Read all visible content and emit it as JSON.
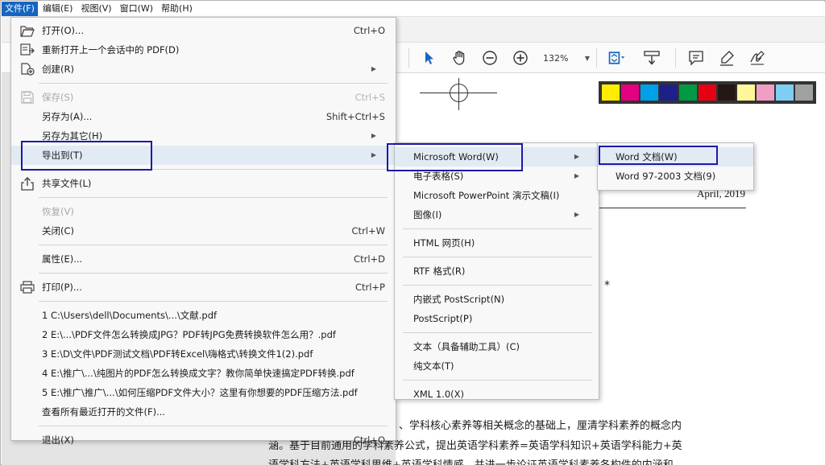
{
  "menubar": {
    "items": [
      "文件(F)",
      "编辑(E)",
      "视图(V)",
      "窗口(W)",
      "帮助(H)"
    ]
  },
  "toolbar": {
    "zoom": "132%",
    "icons": [
      "select-arrow-icon",
      "hand-icon",
      "zoom-out-icon",
      "zoom-in-icon",
      "fit-page-icon",
      "scroll-mode-icon",
      "comment-icon",
      "highlight-pen-icon",
      "sign-icon"
    ]
  },
  "swatches": [
    "#ffee00",
    "#e4007f",
    "#00a0e9",
    "#1d2088",
    "#009944",
    "#e60012",
    "#231815",
    "#fff799",
    "#f19ec2",
    "#7ecef4",
    "#9fa0a0"
  ],
  "file_menu": {
    "open": {
      "label": "打开(O)...",
      "shortcut": "Ctrl+O"
    },
    "reopen": {
      "label": "重新打开上一个会话中的 PDF(D)"
    },
    "create": {
      "label": "创建(R)"
    },
    "save": {
      "label": "保存(S)",
      "shortcut": "Ctrl+S"
    },
    "save_as": {
      "label": "另存为(A)...",
      "shortcut": "Shift+Ctrl+S"
    },
    "save_as_other": {
      "label": "另存为其它(H)"
    },
    "export_to": {
      "label": "导出到(T)"
    },
    "share": {
      "label": "共享文件(L)"
    },
    "revert": {
      "label": "恢复(V)"
    },
    "close": {
      "label": "关闭(C)",
      "shortcut": "Ctrl+W"
    },
    "properties": {
      "label": "属性(E)...",
      "shortcut": "Ctrl+D"
    },
    "print": {
      "label": "打印(P)...",
      "shortcut": "Ctrl+P"
    },
    "recent": [
      "1 C:\\Users\\dell\\Documents\\...\\文献.pdf",
      "2 E:\\...\\PDF文件怎么转换成JPG？PDF转JPG免费转换软件怎么用？.pdf",
      "3 E:\\D\\文件\\PDF测试文档\\PDF转Excel\\嗨格式\\转换文件1(2).pdf",
      "4 E:\\推广\\...\\纯图片的PDF怎么转换成文字？教你简单快速搞定PDF转换.pdf",
      "5 E:\\推广\\推广\\...\\如何压缩PDF文件大小？这里有你想要的PDF压缩方法.pdf"
    ],
    "view_all_recent": {
      "label": "查看所有最近打开的文件(F)..."
    },
    "exit": {
      "label": "退出(X)",
      "shortcut": "Ctrl+Q"
    }
  },
  "export_menu": {
    "word": "Microsoft Word(W)",
    "spreadsheet": "电子表格(S)",
    "powerpoint": "Microsoft PowerPoint 演示文稿(I)",
    "image": "图像(I)",
    "html": "HTML 网页(H)",
    "rtf": "RTF 格式(R)",
    "embedded_ps": "内嵌式 PostScript(N)",
    "postscript": "PostScript(P)",
    "text_accessible": "文本（具备辅助工具）(C)",
    "plain_text": "纯文本(T)",
    "xml": "XML 1.0(X)"
  },
  "word_menu": {
    "docx": "Word 文档(W)",
    "doc": "Word 97-2003 文档(9)"
  },
  "document": {
    "date": "April, 2019",
    "star": "*",
    "line1": "、学科核心素养等相关概念的基础上，厘清学科素养的概念内",
    "line2": "涵。基于目前通用的学科素养公式，提出英语学科素养=英语学科知识+英语学科能力+英",
    "line3": "语学科方法+英语学科思维+英语学科情感。并进一步论证英语学科素养各构件的内涵和"
  }
}
